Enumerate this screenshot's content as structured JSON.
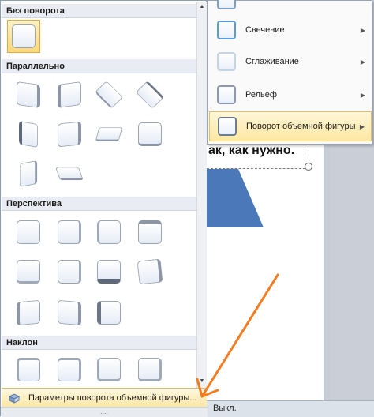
{
  "document": {
    "text": "ак, как нужно.",
    "status_text": "Выкл."
  },
  "submenu": {
    "items": [
      {
        "label": "Свечение",
        "icon": "glow-icon"
      },
      {
        "label": "Сглаживание",
        "icon": "soft-edges-icon"
      },
      {
        "label": "Рельеф",
        "icon": "bevel-icon"
      },
      {
        "label": "Поворот объемной фигуры",
        "icon": "3d-rotation-icon",
        "active": true
      }
    ]
  },
  "gallery": {
    "sections": [
      {
        "title": "Без поворота",
        "count": 1
      },
      {
        "title": "Параллельно",
        "count": 10
      },
      {
        "title": "Перспектива",
        "count": 11
      },
      {
        "title": "Наклон",
        "count": 4
      }
    ],
    "footer_label": "Параметры поворота объемной фигуры...",
    "grip": "....",
    "colors": {
      "accent": "#fde7a4",
      "selected": "#fcd876",
      "arrow": "#f47c20"
    }
  }
}
